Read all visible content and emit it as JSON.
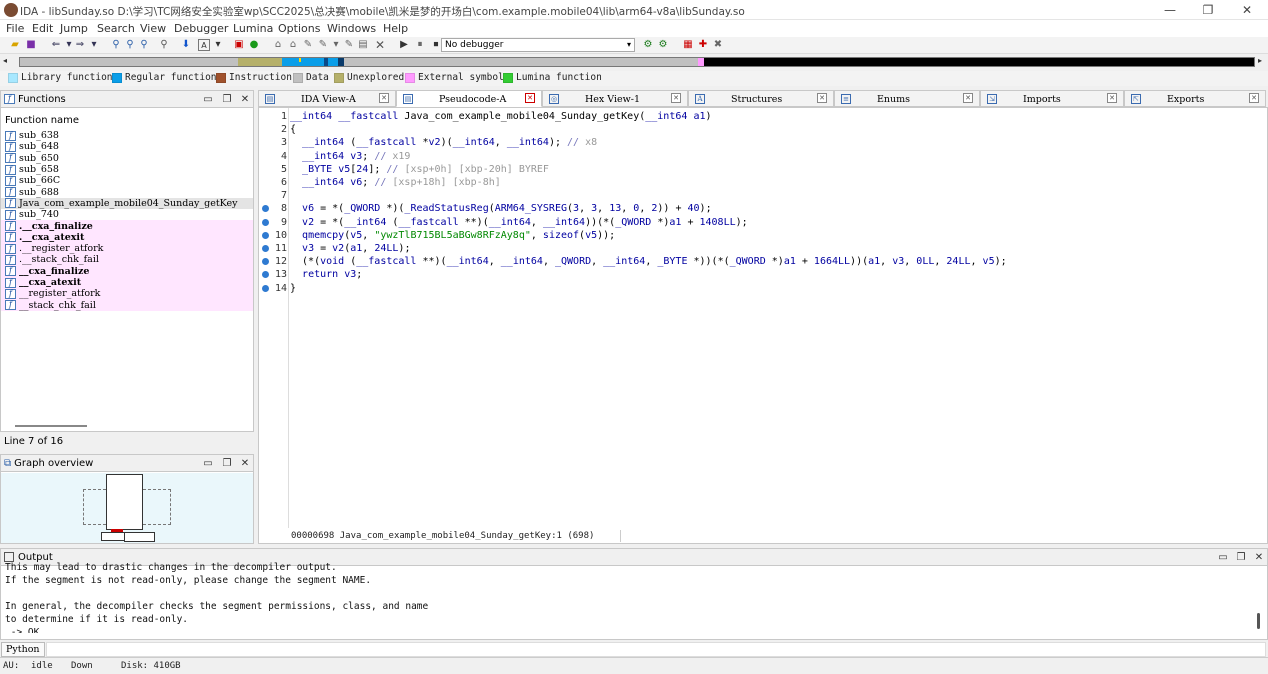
{
  "window": {
    "title": "IDA - libSunday.so D:\\学习\\TC网络安全实验室wp\\SCC2025\\总决赛\\mobile\\凯米是梦的开场白\\com.example.mobile04\\lib\\arm64-v8a\\libSunday.so",
    "controls": {
      "minimize": "—",
      "maximize": "❐",
      "close": "✕"
    }
  },
  "menu": [
    "File",
    "Edit",
    "Jump",
    "Search",
    "View",
    "Debugger",
    "Lumina",
    "Options",
    "Windows",
    "Help"
  ],
  "toolbar": {
    "debugger_value": "No debugger"
  },
  "legend": [
    {
      "label": "Library function",
      "color": "#a8e8ff"
    },
    {
      "label": "Regular function",
      "color": "#0a9ee8"
    },
    {
      "label": "Instruction",
      "color": "#a0522d"
    },
    {
      "label": "Data",
      "color": "#c0c0c0"
    },
    {
      "label": "Unexplored",
      "color": "#b5b06a"
    },
    {
      "label": "External symbol",
      "color": "#ff9aff"
    },
    {
      "label": "Lumina function",
      "color": "#33cc33"
    }
  ],
  "functions": {
    "title": "Functions",
    "column": "Function name",
    "items": [
      {
        "name": "sub_638",
        "type": "regular"
      },
      {
        "name": "sub_648",
        "type": "regular"
      },
      {
        "name": "sub_650",
        "type": "regular"
      },
      {
        "name": "sub_658",
        "type": "regular"
      },
      {
        "name": "sub_66C",
        "type": "regular"
      },
      {
        "name": "sub_688",
        "type": "regular"
      },
      {
        "name": "Java_com_example_mobile04_Sunday_getKey",
        "type": "selected"
      },
      {
        "name": "sub_740",
        "type": "regular"
      },
      {
        "name": ".__cxa_finalize",
        "type": "import-bold"
      },
      {
        "name": ".__cxa_atexit",
        "type": "import-bold"
      },
      {
        "name": ".__register_atfork",
        "type": "import"
      },
      {
        "name": ".__stack_chk_fail",
        "type": "import"
      },
      {
        "name": "__cxa_finalize",
        "type": "import-bold"
      },
      {
        "name": "__cxa_atexit",
        "type": "import-bold"
      },
      {
        "name": "__register_atfork",
        "type": "import"
      },
      {
        "name": "__stack_chk_fail",
        "type": "import"
      }
    ],
    "status": "Line 7 of 16"
  },
  "graph": {
    "title": "Graph overview"
  },
  "tabs": [
    {
      "label": "IDA View-A",
      "icon": "ida-view-icon"
    },
    {
      "label": "Pseudocode-A",
      "icon": "pseudocode-icon"
    },
    {
      "label": "Hex View-1",
      "icon": "hex-view-icon"
    },
    {
      "label": "Structures",
      "icon": "structures-icon"
    },
    {
      "label": "Enums",
      "icon": "enums-icon"
    },
    {
      "label": "Imports",
      "icon": "imports-icon"
    },
    {
      "label": "Exports",
      "icon": "exports-icon"
    }
  ],
  "code": {
    "lines": [
      {
        "n": "1",
        "bp": false,
        "text": "__int64 __fastcall Java_com_example_mobile04_Sunday_getKey(__int64 a1)"
      },
      {
        "n": "2",
        "bp": false,
        "text": "{"
      },
      {
        "n": "3",
        "bp": false,
        "text": "  __int64 (__fastcall *v2)(__int64, __int64); // x8"
      },
      {
        "n": "4",
        "bp": false,
        "text": "  __int64 v3; // x19"
      },
      {
        "n": "5",
        "bp": false,
        "text": "  _BYTE v5[24]; // [xsp+0h] [xbp-20h] BYREF"
      },
      {
        "n": "6",
        "bp": false,
        "text": "  __int64 v6; // [xsp+18h] [xbp-8h]"
      },
      {
        "n": "7",
        "bp": false,
        "text": ""
      },
      {
        "n": "8",
        "bp": true,
        "text": "  v6 = *(_QWORD *)(_ReadStatusReg(ARM64_SYSREG(3, 3, 13, 0, 2)) + 40);"
      },
      {
        "n": "9",
        "bp": true,
        "text": "  v2 = *(__int64 (__fastcall **)(__int64, __int64))(*(_QWORD *)a1 + 1408LL);"
      },
      {
        "n": "10",
        "bp": true,
        "text": "  qmemcpy(v5, \"ywzTlB715BL5aBGw8RFzAy8q\", sizeof(v5));"
      },
      {
        "n": "11",
        "bp": true,
        "text": "  v3 = v2(a1, 24LL);"
      },
      {
        "n": "12",
        "bp": true,
        "text": "  (*(void (__fastcall **)(__int64, __int64, _QWORD, __int64, _BYTE *))(*(_QWORD *)a1 + 1664LL))(a1, v3, 0LL, 24LL, v5);"
      },
      {
        "n": "13",
        "bp": true,
        "text": "  return v3;"
      },
      {
        "n": "14",
        "bp": true,
        "text": "}"
      }
    ],
    "status": "00000698 Java_com_example_mobile04_Sunday_getKey:1 (698)"
  },
  "output": {
    "title": "Output",
    "lines": [
      "This may lead to drastic changes in the decompiler output.",
      "If the segment is not read-only, please change the segment NAME.",
      "",
      "In general, the decompiler checks the segment permissions, class, and name",
      "to determine if it is read-only.",
      " -> OK"
    ]
  },
  "python": {
    "label": "Python"
  },
  "statusbar": {
    "state_label": "AU:",
    "state": "idle",
    "direction": "Down",
    "disk": "Disk: 410GB"
  }
}
